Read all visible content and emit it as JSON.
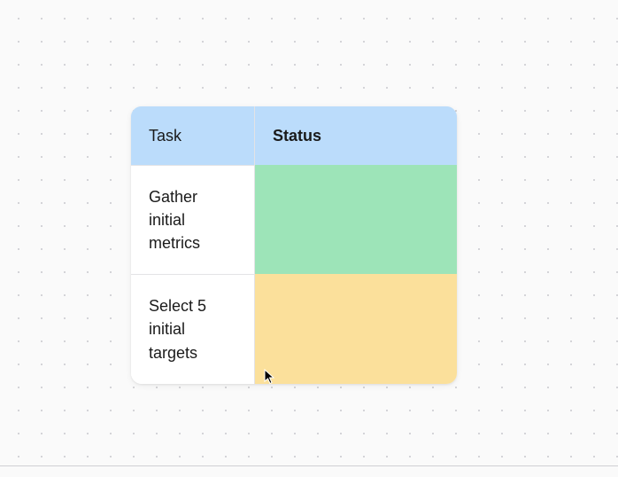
{
  "table": {
    "headers": {
      "task": "Task",
      "status": "Status"
    },
    "rows": [
      {
        "task": "Gather initial metrics",
        "status": "",
        "status_color": "green"
      },
      {
        "task": "Select 5 initial targets",
        "status": "",
        "status_color": "yellow"
      }
    ]
  }
}
